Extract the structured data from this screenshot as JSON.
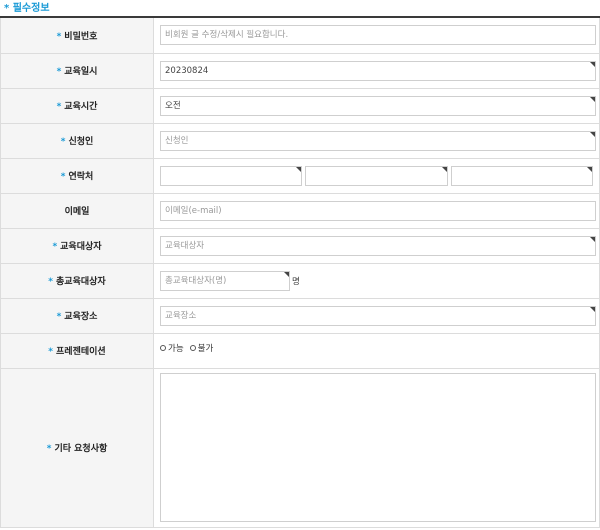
{
  "section": {
    "star": "*",
    "title": "필수정보"
  },
  "required_mark": "*",
  "fields": {
    "password": {
      "label": "비밀번호",
      "placeholder": "비회원 글 수정/삭제시 필요합니다."
    },
    "edu_date": {
      "label": "교육일시",
      "value": "20230824"
    },
    "edu_time": {
      "label": "교육시간",
      "value": "오전"
    },
    "applicant": {
      "label": "신청인",
      "placeholder": "신청인"
    },
    "contact": {
      "label": "연락처"
    },
    "email": {
      "label": "이메일",
      "placeholder": "이메일(e-mail)"
    },
    "target": {
      "label": "교육대상자",
      "placeholder": "교육대상자"
    },
    "total_target": {
      "label": "총교육대상자",
      "placeholder": "총교육대상자(명)",
      "unit": "명"
    },
    "place": {
      "label": "교육장소",
      "placeholder": "교육장소"
    },
    "presentation": {
      "label": "프레젠테이션",
      "options": [
        "가능",
        "불가"
      ]
    },
    "request": {
      "label": "기타 요청사항"
    }
  }
}
